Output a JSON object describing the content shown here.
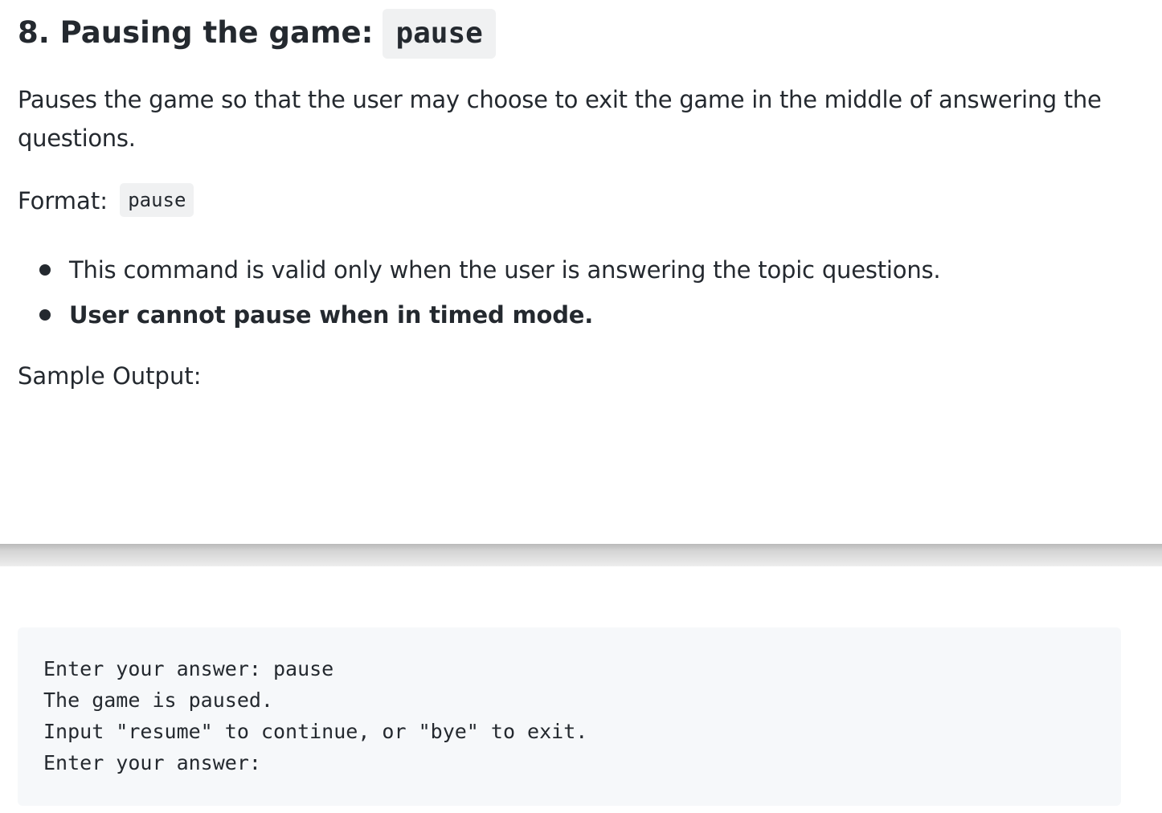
{
  "heading": {
    "text": "8. Pausing the game:",
    "code": "pause"
  },
  "description": "Pauses the game so that the user may choose to exit the game in the middle of answering the questions.",
  "format": {
    "label": "Format:",
    "code": "pause"
  },
  "notes": [
    "This command is valid only when the user is answering the topic questions.",
    "User cannot pause when in timed mode."
  ],
  "sample_label": "Sample Output:",
  "sample_output": [
    "Enter your answer: pause",
    "The game is paused.",
    "Input \"resume\" to continue, or \"bye\" to exit.",
    "Enter your answer:"
  ]
}
